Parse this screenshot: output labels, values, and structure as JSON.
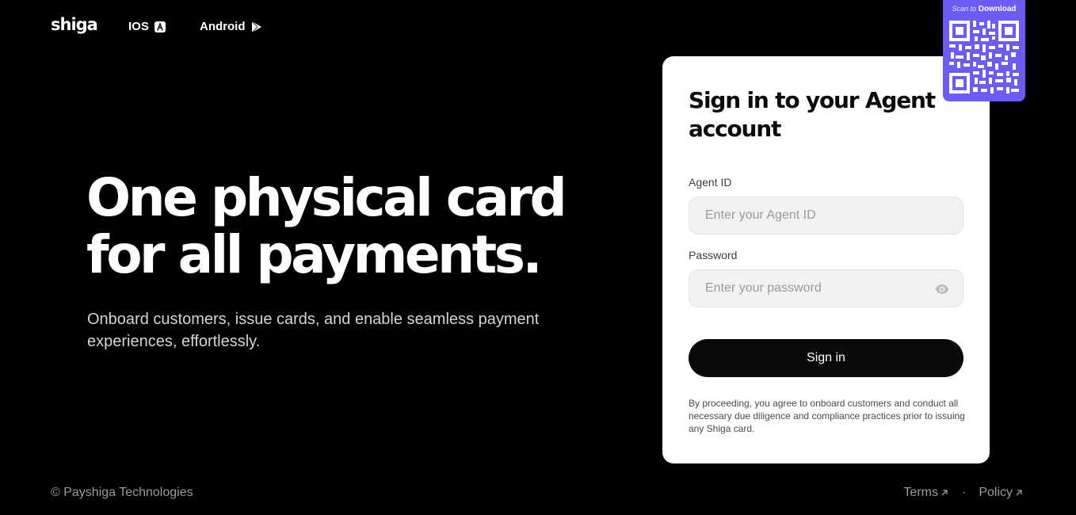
{
  "header": {
    "logo": "shiga",
    "nav": [
      {
        "label": "IOS",
        "icon": "app-store-icon"
      },
      {
        "label": "Android",
        "icon": "play-store-icon"
      }
    ]
  },
  "hero": {
    "title_line1": "One physical card",
    "title_line2": "for all payments.",
    "subtitle": "Onboard customers, issue cards, and enable seamless payment experiences, effortlessly."
  },
  "qr": {
    "caption_small": "Scan to",
    "caption_big": "Download",
    "badge_color": "#6a5cf5"
  },
  "signin": {
    "title": "Sign in to your Agent account",
    "agent_label": "Agent ID",
    "agent_placeholder": "Enter your Agent ID",
    "password_label": "Password",
    "password_placeholder": "Enter your password",
    "button_label": "Sign in",
    "disclaimer": "By proceeding, you agree to onboard customers and conduct all necessary due diligence and compliance practices prior to issuing any Shiga card."
  },
  "footer": {
    "copyright": "© Payshiga Technologies",
    "links": [
      {
        "label": "Terms"
      },
      {
        "label": "Policy"
      }
    ],
    "separator": "·"
  },
  "colors": {
    "background": "#000000",
    "card": "#ffffff",
    "button": "#0a0a0a",
    "accent": "#6a5cf5"
  }
}
